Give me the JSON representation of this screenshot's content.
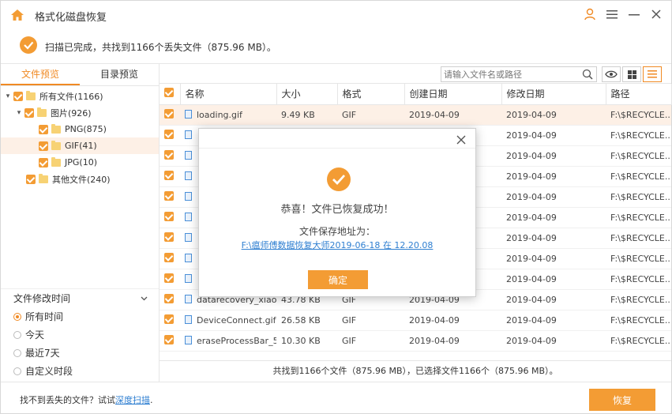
{
  "app": {
    "title": "格式化磁盘恢复"
  },
  "status": {
    "text": "扫描已完成，共找到1166个丢失文件（875.96 MB）。"
  },
  "tabs": [
    {
      "label": "文件预览"
    },
    {
      "label": "目录预览"
    }
  ],
  "tree": [
    {
      "label": "所有文件(1166)"
    },
    {
      "label": "图片(926)"
    },
    {
      "label": "PNG(875)"
    },
    {
      "label": "GIF(41)"
    },
    {
      "label": "JPG(10)"
    },
    {
      "label": "其他文件(240)"
    }
  ],
  "filter": {
    "title": "文件修改时间",
    "options": [
      "所有时间",
      "今天",
      "最近7天",
      "自定义时段"
    ]
  },
  "search": {
    "placeholder": "请输入文件名或路径"
  },
  "table": {
    "headers": [
      "名称",
      "大小",
      "格式",
      "创建日期",
      "修改日期",
      "路径"
    ],
    "rows": [
      {
        "name": "loading.gif",
        "size": "9.49 KB",
        "format": "GIF",
        "created": "2019-04-09",
        "modified": "2019-04-09",
        "path": "F:\\$RECYCLE..."
      },
      {
        "name": "",
        "size": "",
        "format": "",
        "created": "",
        "modified": "2019-04-09",
        "path": "F:\\$RECYCLE..."
      },
      {
        "name": "",
        "size": "",
        "format": "",
        "created": "",
        "modified": "2019-04-09",
        "path": "F:\\$RECYCLE..."
      },
      {
        "name": "",
        "size": "",
        "format": "",
        "created": "",
        "modified": "2019-04-09",
        "path": "F:\\$RECYCLE..."
      },
      {
        "name": "",
        "size": "",
        "format": "",
        "created": "",
        "modified": "2019-04-09",
        "path": "F:\\$RECYCLE..."
      },
      {
        "name": "",
        "size": "",
        "format": "",
        "created": "",
        "modified": "2019-04-09",
        "path": "F:\\$RECYCLE..."
      },
      {
        "name": "",
        "size": "",
        "format": "",
        "created": "",
        "modified": "2019-04-09",
        "path": "F:\\$RECYCLE..."
      },
      {
        "name": "",
        "size": "",
        "format": "",
        "created": "",
        "modified": "2019-04-09",
        "path": "F:\\$RECYCLE..."
      },
      {
        "name": "",
        "size": "",
        "format": "",
        "created": "",
        "modified": "2019-04-09",
        "path": "F:\\$RECYCLE..."
      },
      {
        "name": "datarecovery_xiao.gif",
        "size": "43.78 KB",
        "format": "GIF",
        "created": "2019-04-09",
        "modified": "2019-04-09",
        "path": "F:\\$RECYCLE..."
      },
      {
        "name": "DeviceConnect.gif",
        "size": "26.58 KB",
        "format": "GIF",
        "created": "2019-04-09",
        "modified": "2019-04-09",
        "path": "F:\\$RECYCLE..."
      },
      {
        "name": "eraseProcessBar_5...",
        "size": "10.30 KB",
        "format": "GIF",
        "created": "2019-04-09",
        "modified": "2019-04-09",
        "path": "F:\\$RECYCLE..."
      }
    ]
  },
  "summary": {
    "text": "共找到1166个文件（875.96 MB），已选择文件1166个（875.96 MB）。"
  },
  "bottom": {
    "prefix": "找不到丢失的文件？试试",
    "link": "深度扫描",
    "suffix": ".",
    "recover": "恢复"
  },
  "dialog": {
    "message": "恭喜！文件已恢复成功！",
    "label": "文件保存地址为：",
    "path": "F:\\瘟师傅数据恢复大师2019-06-18 在 12.20.08",
    "ok": "确定"
  },
  "colors": {
    "accent": "#f39c34",
    "link": "#2f7fd1",
    "highlight": "#fdf0e6"
  },
  "icons": [
    "home-icon",
    "user-icon",
    "menu-icon",
    "minimize-icon",
    "close-icon",
    "check-icon",
    "folder-icon",
    "file-icon",
    "search-icon",
    "eye-icon",
    "grid-icon",
    "list-icon",
    "chevron-down-icon"
  ]
}
